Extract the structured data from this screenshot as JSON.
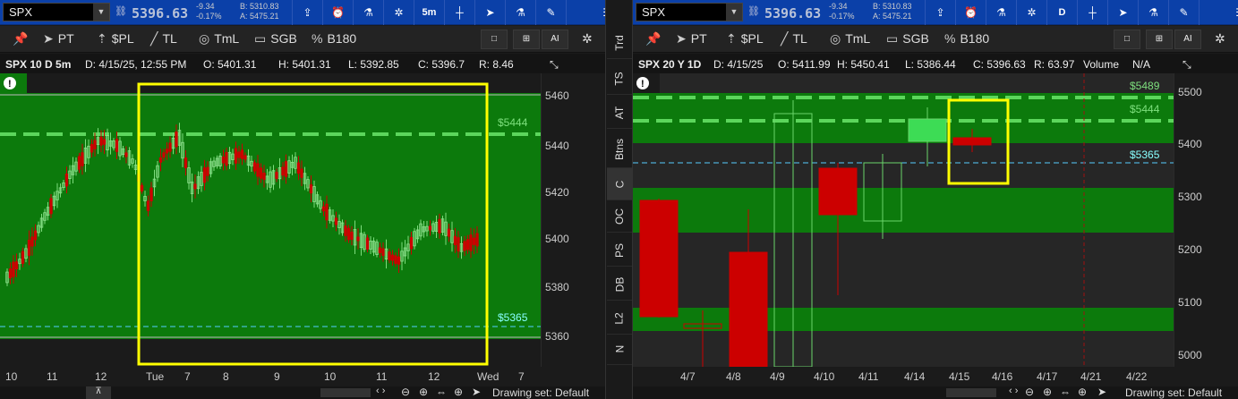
{
  "left": {
    "symbol": "SPX",
    "price": "5396.63",
    "change": "-9.34",
    "change_pct": "-0.17%",
    "bid": "B: 5310.83",
    "ask": "A: 5475.21",
    "interval": "5m",
    "tools": [
      "PT",
      "$PL",
      "TL",
      "TmL",
      "SGB",
      "B180"
    ],
    "info": {
      "title": "SPX 10 D 5m",
      "date": "D: 4/15/25, 12:55 PM",
      "open": "O: 5401.31",
      "high": "H: 5401.31",
      "low": "L: 5392.85",
      "close": "C: 5396.7",
      "range": "R: 8.46"
    },
    "y_ticks": [
      "5460",
      "5440",
      "5420",
      "5400",
      "5380",
      "5360"
    ],
    "x_ticks": [
      "10",
      "11",
      "12",
      "Tue",
      "7",
      "8",
      "9",
      "10",
      "11",
      "12",
      "Wed",
      "7"
    ],
    "levels": {
      "upper": "$5444",
      "lower": "$5365"
    },
    "drawing_set": "Drawing set: Default"
  },
  "right": {
    "symbol": "SPX",
    "price": "5396.63",
    "change": "-9.34",
    "change_pct": "-0.17%",
    "bid": "B: 5310.83",
    "ask": "A: 5475.21",
    "interval": "D",
    "tools": [
      "PT",
      "$PL",
      "TL",
      "TmL",
      "SGB",
      "B180"
    ],
    "info": {
      "title": "SPX 20 Y 1D",
      "date": "D: 4/15/25",
      "open": "O: 5411.99",
      "high": "H: 5450.41",
      "low": "L: 5386.44",
      "close": "C: 5396.63",
      "range": "R: 63.97",
      "volume": "Volume",
      "na": "N/A"
    },
    "y_ticks": [
      "5500",
      "5400",
      "5300",
      "5200",
      "5100",
      "5000"
    ],
    "x_ticks": [
      "4/7",
      "4/8",
      "4/9",
      "4/10",
      "4/11",
      "4/14",
      "4/15",
      "4/16",
      "4/17",
      "4/21",
      "4/22"
    ],
    "levels": {
      "l1": "$5489",
      "l2": "$5444",
      "l3": "$5365"
    },
    "drawing_set": "Drawing set: Default"
  },
  "side_tabs": [
    "Trd",
    "TS",
    "AT",
    "Btns",
    "C",
    "OC",
    "PS",
    "DB",
    "L2",
    "N"
  ],
  "colors": {
    "green_zone": "#0c7a0c",
    "up": "#3ddc55",
    "down": "#cc0000",
    "highlight": "#ffff00",
    "toolbar": "#0b40a8"
  }
}
